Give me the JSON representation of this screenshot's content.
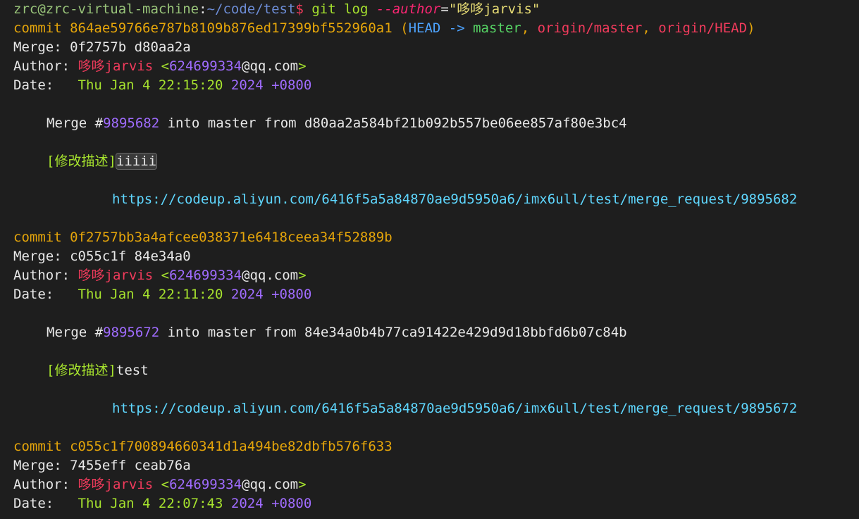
{
  "prompt": {
    "user_host": "zrc@zrc-virtual-machine",
    "sep": ":",
    "path": "~/code/test",
    "symbol": "$",
    "cmd": "git log",
    "flag": "--author",
    "eq": "=",
    "arg": "\"哆哆jarvis\""
  },
  "commits": [
    {
      "label": "commit",
      "hash": "864ae59766e787b8109b876ed17399bf552960a1",
      "refs": {
        "open": "(",
        "head": "HEAD -> ",
        "master": "master",
        "comma1": ", ",
        "origin_master": "origin/master",
        "comma2": ", ",
        "origin_head": "origin/HEAD",
        "close": ")"
      },
      "merge_label": "Merge:",
      "merge": "0f2757b d80aa2a",
      "author_label": "Author:",
      "author_name": "哆哆jarvis",
      "email_open": "<",
      "email_num": "624699334",
      "email_domain": "@qq.com",
      "email_close": ">",
      "date_label": "Date:",
      "date_text": "Thu Jan 4 22:15:20",
      "date_year": "2024",
      "date_tz": "+0800",
      "msg_prefix": "Merge #",
      "msg_pr": "9895682",
      "msg_rest": " into master from d80aa2a584bf21b092b557be06ee857af80e3bc4",
      "desc_bracket": "[修改描述]",
      "desc_text": "iiiii",
      "url": "https://codeup.aliyun.com/6416f5a5a84870ae9d5950a6/imx6ull/test/merge_request/9895682"
    },
    {
      "label": "commit",
      "hash": "0f2757bb3a4afcee038371e6418ceea34f52889b",
      "merge_label": "Merge:",
      "merge": "c055c1f 84e34a0",
      "author_label": "Author:",
      "author_name": "哆哆jarvis",
      "email_open": "<",
      "email_num": "624699334",
      "email_domain": "@qq.com",
      "email_close": ">",
      "date_label": "Date:",
      "date_text": "Thu Jan 4 22:11:20",
      "date_year": "2024",
      "date_tz": "+0800",
      "msg_prefix": "Merge #",
      "msg_pr": "9895672",
      "msg_rest": " into master from 84e34a0b4b77ca91422e429d9d18bbfd6b07c84b",
      "desc_bracket": "[修改描述]",
      "desc_text": "test",
      "url": "https://codeup.aliyun.com/6416f5a5a84870ae9d5950a6/imx6ull/test/merge_request/9895672"
    },
    {
      "label": "commit",
      "hash": "c055c1f700894660341d1a494be82dbfb576f633",
      "merge_label": "Merge:",
      "merge": "7455eff ceab76a",
      "author_label": "Author:",
      "author_name": "哆哆jarvis",
      "email_open": "<",
      "email_num": "624699334",
      "email_domain": "@qq.com",
      "email_close": ">",
      "date_label": "Date:",
      "date_text": "Thu Jan 4 22:07:43",
      "date_year": "2024",
      "date_tz": "+0800"
    }
  ]
}
